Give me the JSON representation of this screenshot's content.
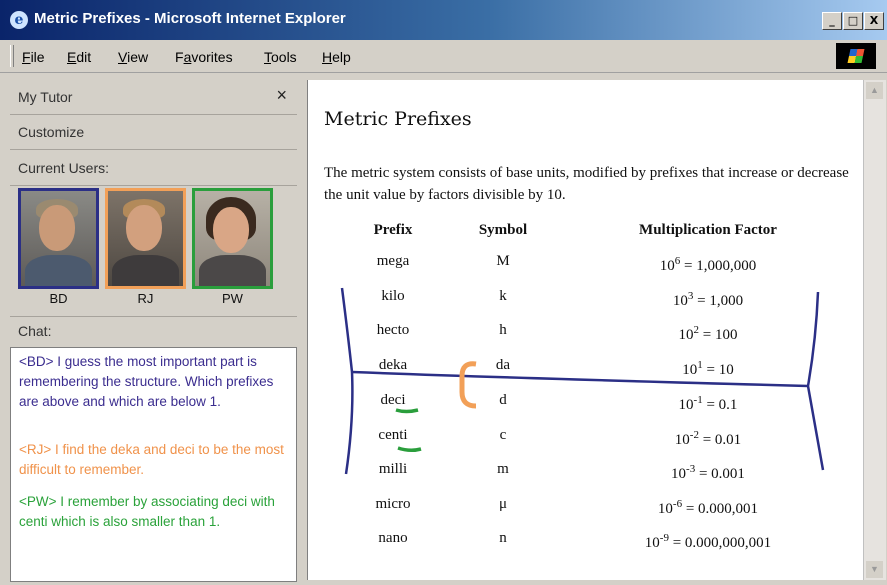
{
  "window": {
    "title": "Metric Prefixes - Microsoft Internet Explorer",
    "min_glyph": "_",
    "max_glyph": "□",
    "close_glyph": "X"
  },
  "menu": [
    {
      "label": "File",
      "underline": "F",
      "rest": "ile"
    },
    {
      "label": "Edit",
      "underline": "E",
      "rest": "dit"
    },
    {
      "label": "View",
      "underline": "V",
      "rest": "iew"
    },
    {
      "label": "Favorites",
      "underline": "a",
      "pre": "F",
      "rest": "vorites"
    },
    {
      "label": "Tools",
      "underline": "T",
      "rest": "ools"
    },
    {
      "label": "Help",
      "underline": "H",
      "rest": "elp"
    }
  ],
  "sidebar": {
    "title": "My Tutor",
    "close_glyph": "×",
    "customize": "Customize",
    "current_users": "Current Users:",
    "users": [
      {
        "name": "BD",
        "border": "#2b2f86"
      },
      {
        "name": "RJ",
        "border": "#f2a058"
      },
      {
        "name": "PW",
        "border": "#2a9e3c"
      }
    ],
    "chat_label": "Chat:",
    "chat": [
      {
        "text": "<BD> I guess the most important part is remembering the structure. Which prefixes are above and which are below 1.",
        "color": "#3b2d8f"
      },
      {
        "text": "<RJ> I find the deka and deci to be the most difficult to remember.",
        "color": "#f0924a"
      },
      {
        "text": "<PW> I remember by associating deci with centi which is also smaller than 1.",
        "color": "#2aa23a"
      }
    ]
  },
  "page": {
    "title": "Metric Prefixes",
    "intro": "The metric system consists of base units, modified by prefixes that increase or decrease the unit value by factors divisible by 10.",
    "headers": {
      "prefix": "Prefix",
      "symbol": "Symbol",
      "factor": "Multiplication Factor"
    },
    "rows": [
      {
        "prefix": "mega",
        "symbol": "M",
        "base": "10",
        "exp": "6",
        "value": " = 1,000,000"
      },
      {
        "prefix": "kilo",
        "symbol": "k",
        "base": "10",
        "exp": "3",
        "value": " = 1,000"
      },
      {
        "prefix": "hecto",
        "symbol": "h",
        "base": "10",
        "exp": "2",
        "value": " = 100"
      },
      {
        "prefix": "deka",
        "symbol": "da",
        "base": "10",
        "exp": "1",
        "value": " = 10"
      },
      {
        "prefix": "deci",
        "symbol": "d",
        "base": "10",
        "exp": "-1",
        "value": " = 0.1"
      },
      {
        "prefix": "centi",
        "symbol": "c",
        "base": "10",
        "exp": "-2",
        "value": " = 0.01"
      },
      {
        "prefix": "milli",
        "symbol": "m",
        "base": "10",
        "exp": "-3",
        "value": " = 0.001"
      },
      {
        "prefix": "micro",
        "symbol": "μ",
        "base": "10",
        "exp": "-6",
        "value": " = 0.000,001"
      },
      {
        "prefix": "nano",
        "symbol": "n",
        "base": "10",
        "exp": "-9",
        "value": " = 0.000,000,001"
      }
    ]
  },
  "colors": {
    "annotation_blue": "#2b2f86",
    "annotation_orange": "#f2a058",
    "annotation_green": "#2a9e3c"
  }
}
